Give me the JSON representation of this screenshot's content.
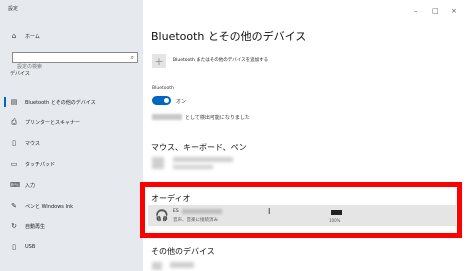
{
  "app": {
    "title": "設定"
  },
  "window": {
    "minimize": "–",
    "maximize": "□",
    "close": "×"
  },
  "sidebar": {
    "home": "ホーム",
    "search_placeholder": "設定の検索",
    "section": "デバイス",
    "items": [
      {
        "label": "Bluetooth とその他のデバイス",
        "icon": "bluetooth-devices-icon",
        "glyph": "▤",
        "active": true
      },
      {
        "label": "プリンターとスキャナー",
        "icon": "printer-icon",
        "glyph": "⎙"
      },
      {
        "label": "マウス",
        "icon": "mouse-icon",
        "glyph": "▯"
      },
      {
        "label": "タッチパッド",
        "icon": "touchpad-icon",
        "glyph": "▭"
      },
      {
        "label": "入力",
        "icon": "keyboard-icon",
        "glyph": "⌨"
      },
      {
        "label": "ペンと Windows Ink",
        "icon": "pen-icon",
        "glyph": "✎"
      },
      {
        "label": "自動再生",
        "icon": "autoplay-icon",
        "glyph": "↻"
      },
      {
        "label": "USB",
        "icon": "usb-icon",
        "glyph": "▯"
      }
    ]
  },
  "main": {
    "title": "Bluetooth とその他のデバイス",
    "add_device_label": "Bluetooth またはその他のデバイスを追加する",
    "bluetooth_label": "Bluetooth",
    "bluetooth_state": "オン",
    "discoverable_text": "として検出可能になりました",
    "mouse_section": "マウス、キーボード、ペン",
    "audio_section": "オーディオ",
    "audio_device": {
      "name": "ES",
      "status": "音声、音楽に接続済み",
      "battery": "100%"
    },
    "other_section": "その他のデバイス"
  },
  "colors": {
    "accent": "#0067c0",
    "highlight": "#ff0000",
    "sidebar_bg": "#e6eaee"
  }
}
